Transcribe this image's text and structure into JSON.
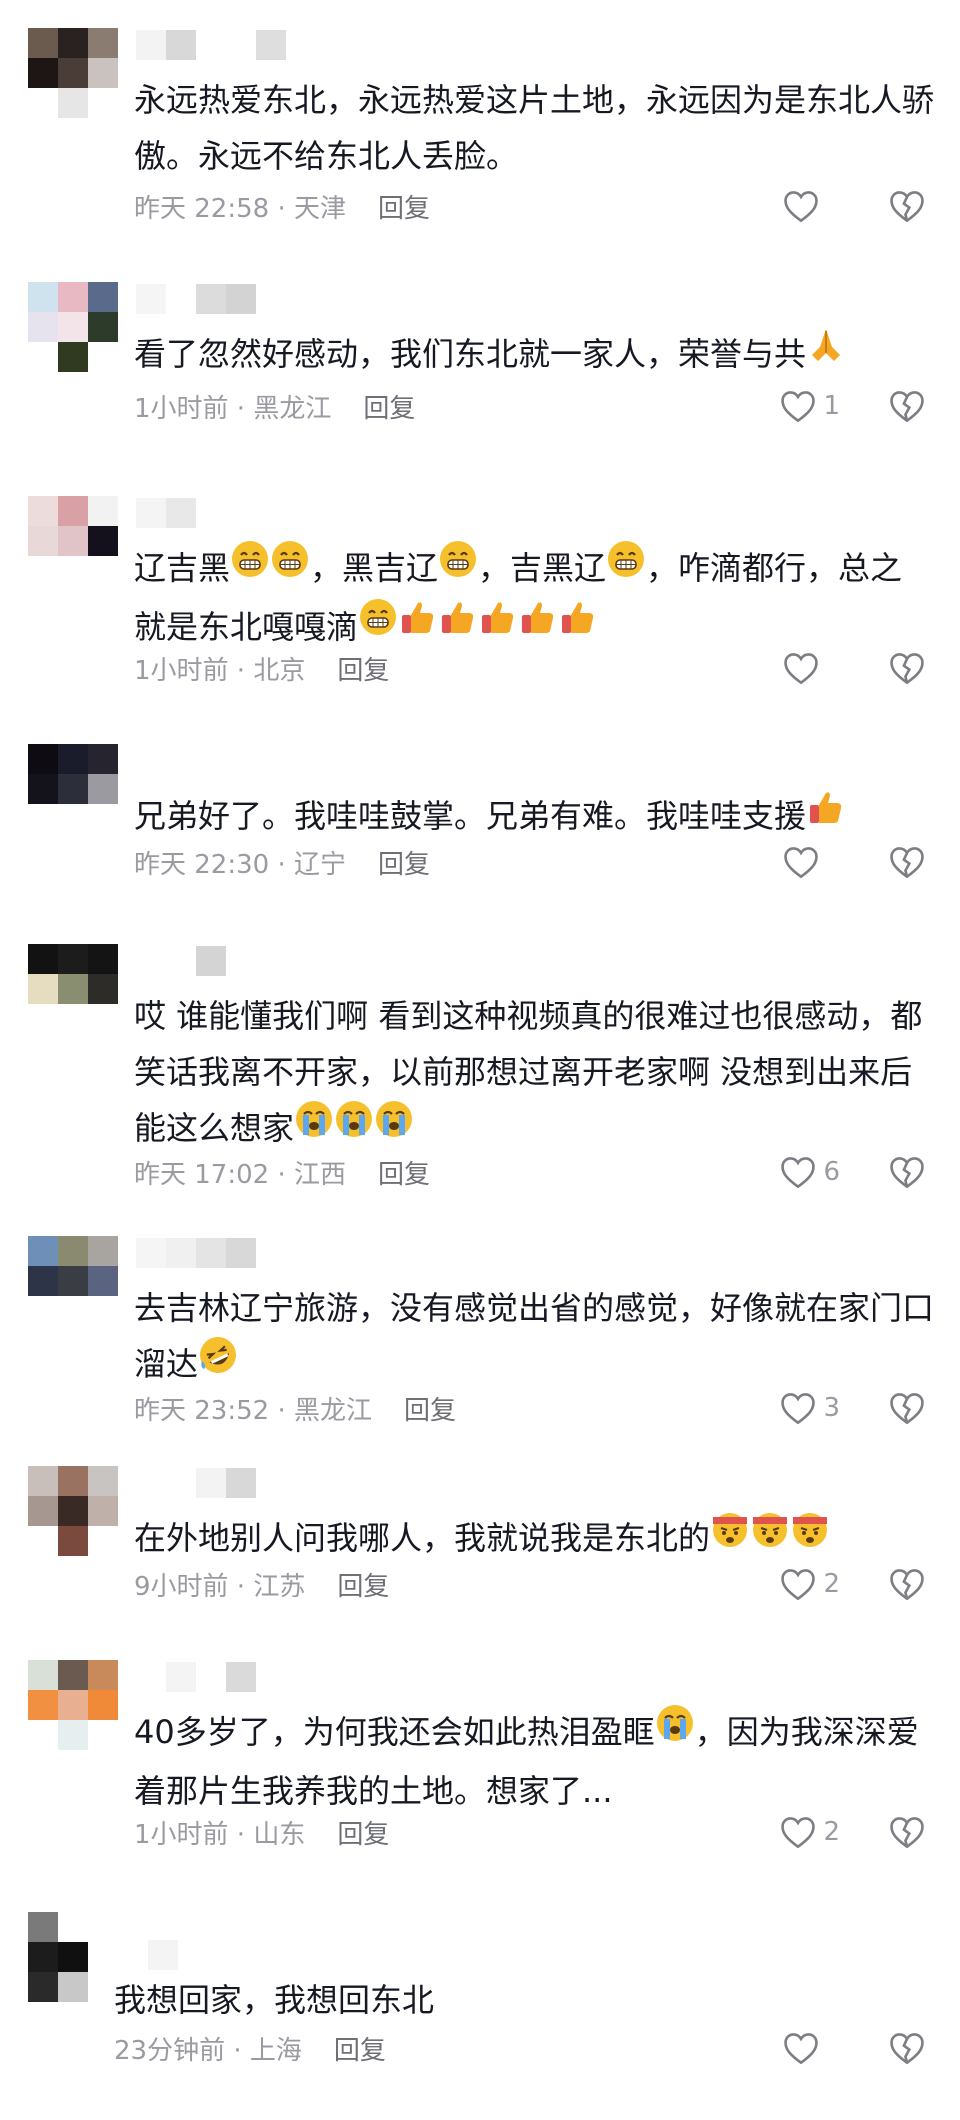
{
  "reply_label": "回复",
  "icons": {
    "like": "heart-outline-icon",
    "dislike": "broken-heart-icon"
  },
  "colors": {
    "text": "#161823",
    "meta": "#9a9aa2",
    "grin": "#f5c02b",
    "thumb": "#f5a623",
    "thumb_cuff": "#e0524d",
    "cry": "#5ba8f0"
  },
  "comments": [
    {
      "text_parts": [
        "永远热爱东北，永远热爱这片土地，永远因为是东北人骄傲。永远不给东北人丢脸。"
      ],
      "meta": "昨天 22:58 · 天津",
      "likes": ""
    },
    {
      "text_parts": [
        "看了忽然好感动，我们东北就一家人，荣誉与共"
      ],
      "emoji": "folded-hands",
      "meta": "1小时前 · 黑龙江",
      "likes": "1"
    },
    {
      "text_parts": [
        "辽吉黑",
        "，黑吉辽",
        "，吉黑辽",
        "，咋滴都行，总之就是东北嘎嘎滴"
      ],
      "meta": "1小时前 · 北京",
      "likes": ""
    },
    {
      "text_parts": [
        "兄弟好了。我哇哇鼓掌。兄弟有难。我哇哇支援"
      ],
      "meta": "昨天 22:30 · 辽宁",
      "likes": ""
    },
    {
      "text_parts": [
        "哎 谁能懂我们啊 看到这种视频真的很难过也很感动，都笑话我离不开家，以前那想过离开老家啊 没想到出来后能这么想家"
      ],
      "meta": "昨天 17:02 · 江西",
      "likes": "6"
    },
    {
      "text_parts": [
        "去吉林辽宁旅游，没有感觉出省的感觉，好像就在家门口溜达"
      ],
      "meta": "昨天 23:52 · 黑龙江",
      "likes": "3"
    },
    {
      "text_parts": [
        "在外地别人问我哪人，我就说我是东北的"
      ],
      "meta": "9小时前 · 江苏",
      "likes": "2"
    },
    {
      "text_parts": [
        "40多岁了，为何我还会如此热泪盈眶",
        "，因为我深深爱着那片生我养我的土地。想家了..."
      ],
      "meta": "1小时前 · 山东",
      "likes": "2"
    },
    {
      "text_parts": [
        "我想回家，我想回东北"
      ],
      "meta": "23分钟前 · 上海",
      "likes": ""
    }
  ]
}
